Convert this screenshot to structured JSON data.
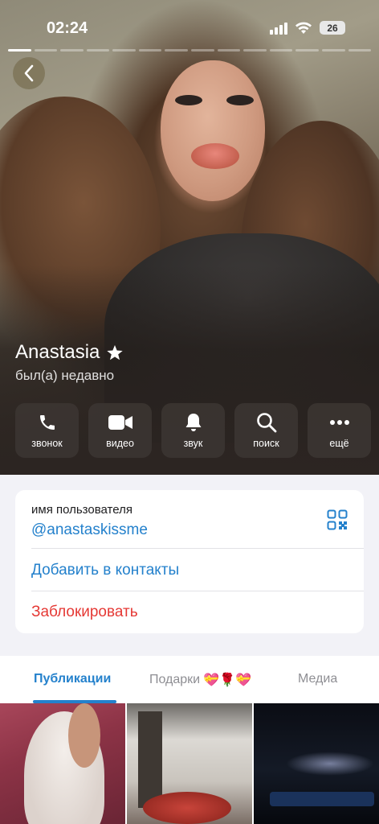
{
  "status_bar": {
    "time": "02:24",
    "battery": "26"
  },
  "profile": {
    "name": "Anastasia",
    "last_seen": "был(а) недавно"
  },
  "actions": [
    {
      "label": "звонок",
      "icon": "phone-icon"
    },
    {
      "label": "видео",
      "icon": "video-camera-icon"
    },
    {
      "label": "звук",
      "icon": "bell-icon"
    },
    {
      "label": "поиск",
      "icon": "search-icon"
    },
    {
      "label": "ещё",
      "icon": "more-dots-icon"
    }
  ],
  "info": {
    "username_label": "имя пользователя",
    "username": "@anastaskissme",
    "add_contact": "Добавить в контакты",
    "block": "Заблокировать"
  },
  "tabs": [
    {
      "label": "Публикации",
      "active": true
    },
    {
      "label": "Подарки",
      "emojis": "💝🌹💝",
      "active": false
    },
    {
      "label": "Медиа",
      "active": false
    }
  ],
  "colors": {
    "accent": "#2481cc",
    "danger": "#e53935"
  }
}
